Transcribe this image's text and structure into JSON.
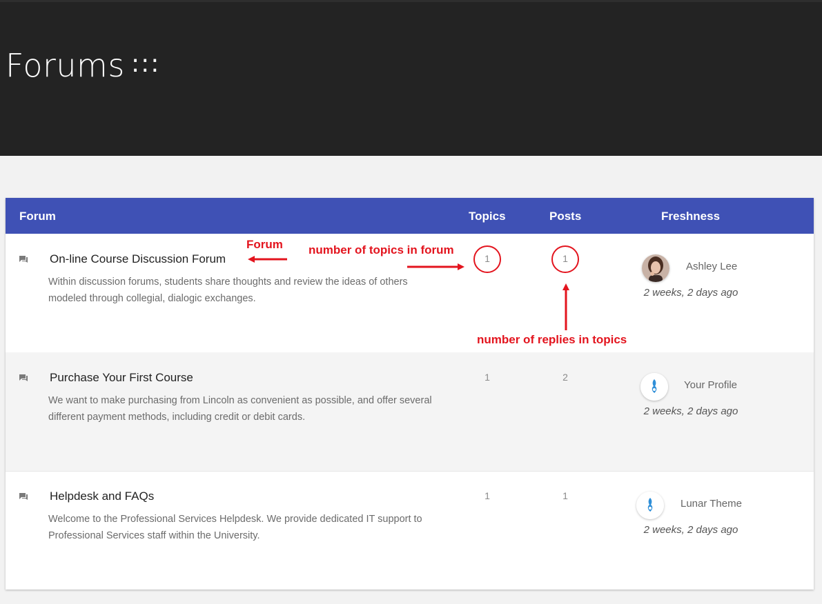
{
  "page": {
    "title": "Forums",
    "menu_glyph": ":::"
  },
  "table": {
    "headers": {
      "forum": "Forum",
      "topics": "Topics",
      "posts": "Posts",
      "freshness": "Freshness"
    },
    "rows": [
      {
        "title": "On-line Course Discussion Forum",
        "desc": "Within discussion forums, students share thoughts and review the ideas of others modeled through collegial, dialogic exchanges.",
        "topics": "1",
        "posts": "1",
        "author": "Ashley Lee",
        "freshness": "2 weeks, 2 days ago",
        "avatar": "person-photo"
      },
      {
        "title": "Purchase Your First Course",
        "desc": "We want to make purchasing from Lincoln as convenient as possible, and offer several different payment methods, including credit or debit cards.",
        "topics": "1",
        "posts": "2",
        "author": "Your Profile",
        "freshness": "2 weeks, 2 days ago",
        "avatar": "default-logo"
      },
      {
        "title": "Helpdesk and FAQs",
        "desc": "Welcome to the Professional Services Helpdesk. We provide dedicated IT support to Professional Services staff within the University.",
        "topics": "1",
        "posts": "1",
        "author": "Lunar Theme",
        "freshness": "2 weeks, 2 days ago",
        "avatar": "default-logo"
      }
    ]
  },
  "annotations": {
    "forum": "Forum",
    "topics_note": "number of topics in forum",
    "replies_note": "number of replies in topics",
    "color": "#e3141e"
  },
  "colors": {
    "header_bg": "#232323",
    "table_header": "#3f51b5",
    "alt_row": "#f4f4f4"
  }
}
